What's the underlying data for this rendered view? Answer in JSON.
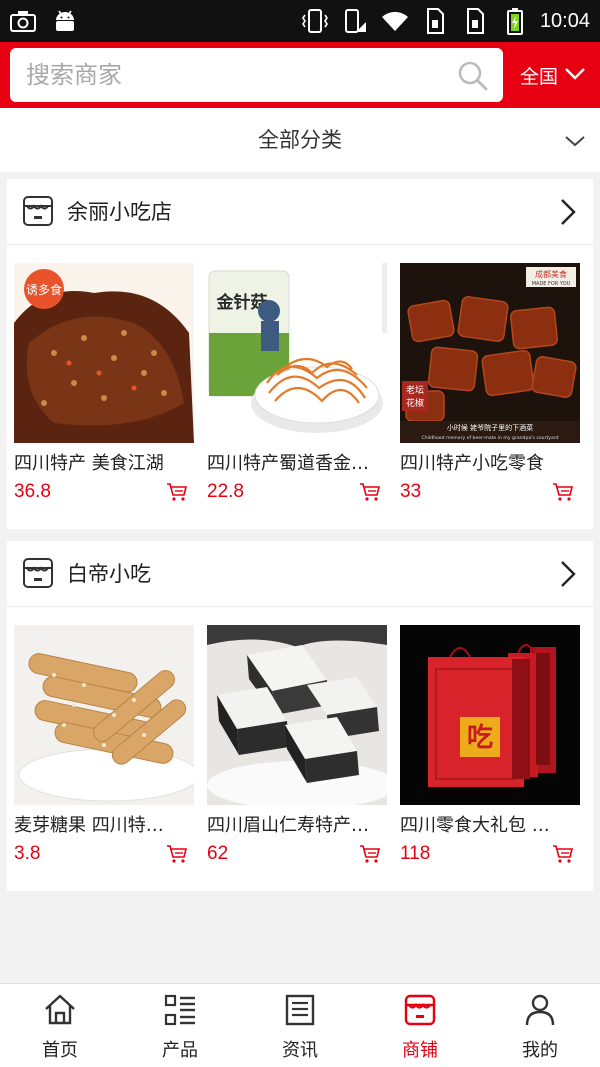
{
  "status_bar": {
    "time": "10:04"
  },
  "search": {
    "placeholder": "搜索商家",
    "region_label": "全国"
  },
  "category": {
    "label": "全部分类"
  },
  "shops": [
    {
      "name": "余丽小吃店",
      "products": [
        {
          "name": "四川特产 美食江湖",
          "price": "36.8"
        },
        {
          "name": "四川特产蜀道香金针菇",
          "price": "22.8"
        },
        {
          "name": "四川特产小吃零食",
          "price": "33"
        }
      ],
      "image_texts": {
        "badge": "诱多食",
        "bag_title": "金针菇",
        "bowl_tag": "成都美食",
        "bowl_tag_sub": "MADE FOR YOU",
        "stamp_line1": "老坛",
        "stamp_line2": "花椒",
        "caption": "小时候 姥爷院子里的下酒菜",
        "caption_en": "Childhood memory of beer-mate in my grandpa's courtyard"
      }
    },
    {
      "name": "白帝小吃",
      "products": [
        {
          "name": "麦芽糖果 四川特产零食",
          "price": "3.8"
        },
        {
          "name": "四川眉山仁寿特产芝麻糕",
          "price": "62"
        },
        {
          "name": "四川零食大礼包 特产",
          "price": "118"
        }
      ],
      "image_texts": {
        "gift_box": "吃"
      }
    }
  ],
  "tabs": [
    {
      "label": "首页",
      "active": false
    },
    {
      "label": "产品",
      "active": false
    },
    {
      "label": "资讯",
      "active": false
    },
    {
      "label": "商铺",
      "active": true
    },
    {
      "label": "我的",
      "active": false
    }
  ],
  "colors": {
    "brand": "#e60012",
    "background": "#f2f2f2",
    "text": "#222222"
  }
}
